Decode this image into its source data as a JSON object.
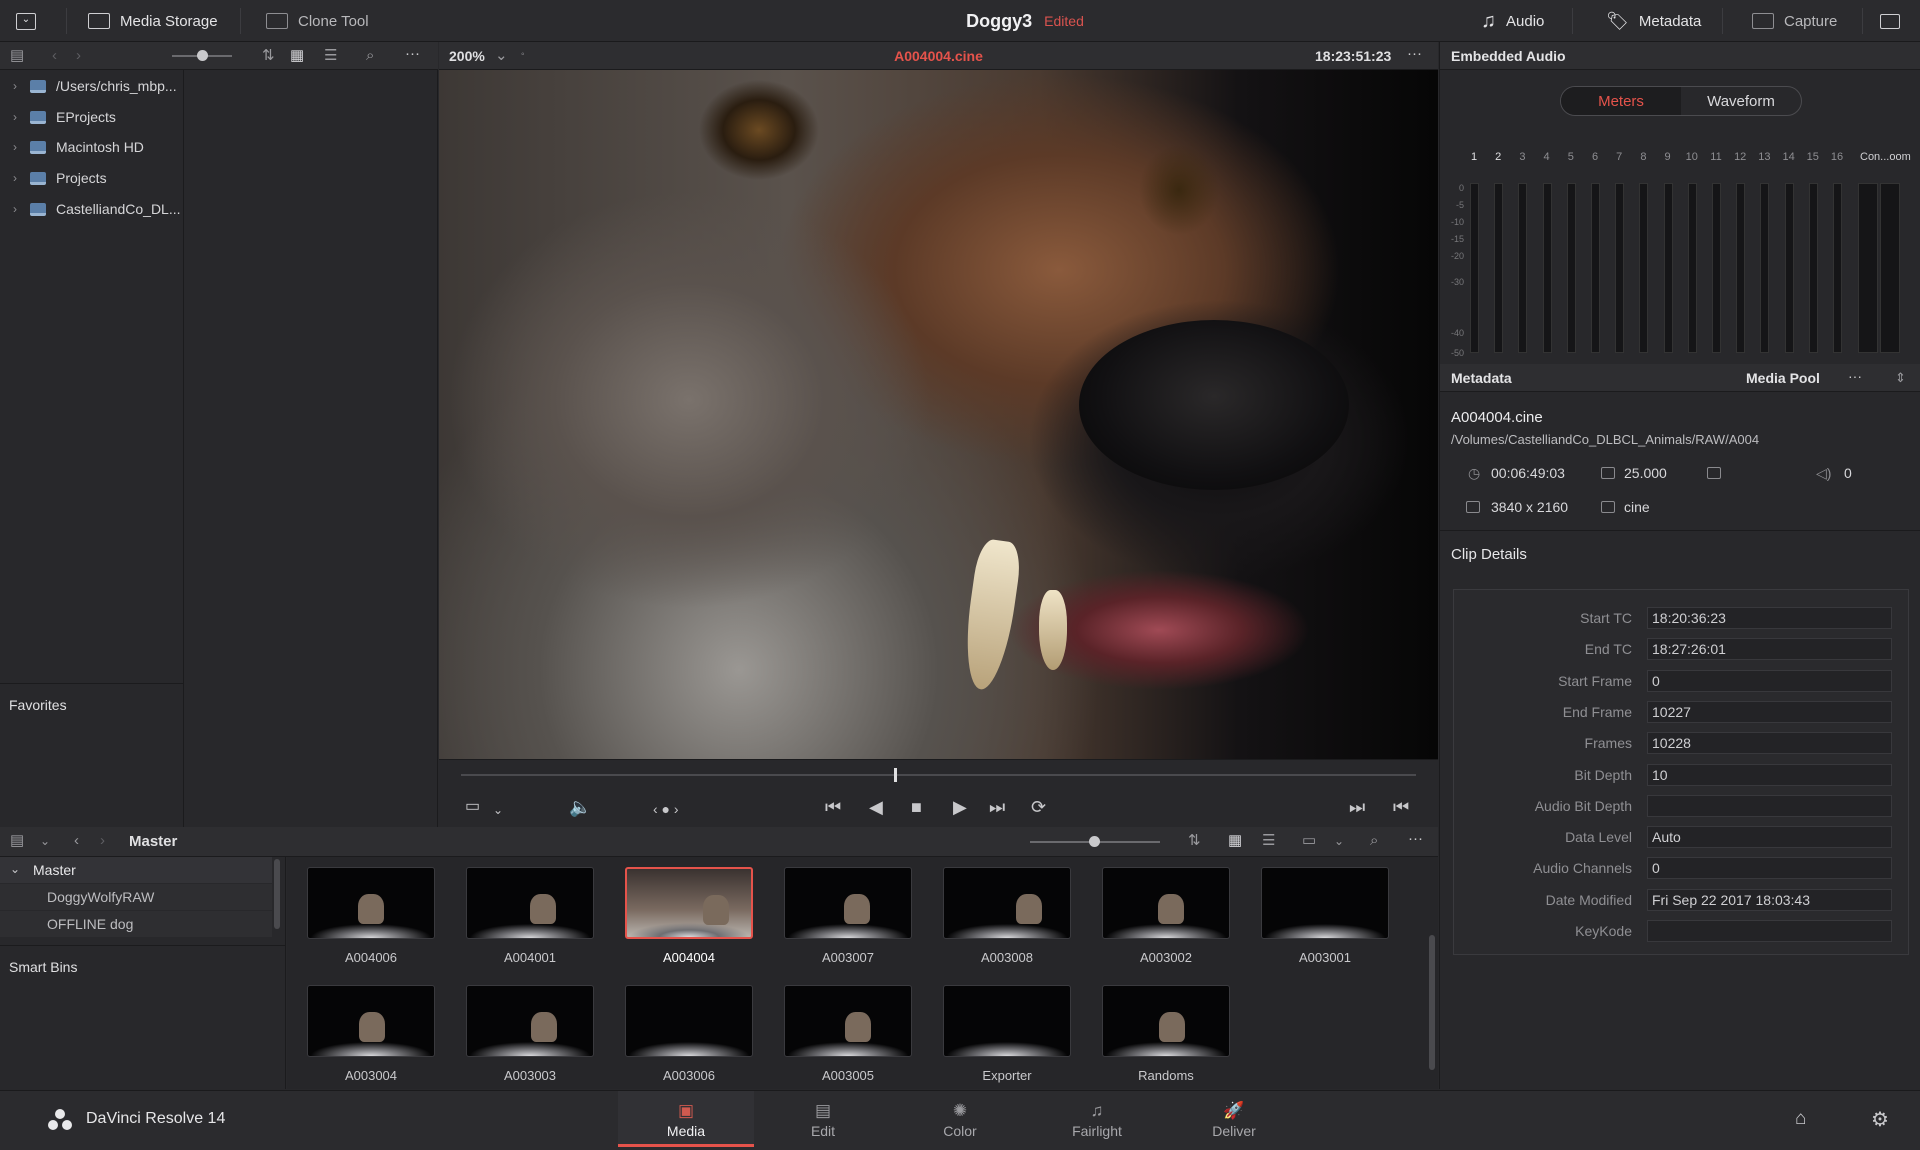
{
  "app": {
    "name": "DaVinci Resolve 14"
  },
  "topbar": {
    "media_storage": "Media Storage",
    "clone_tool": "Clone Tool",
    "project_title": "Doggy3",
    "project_status": "Edited",
    "audio": "Audio",
    "metadata": "Metadata",
    "capture": "Capture"
  },
  "browser": {
    "items": [
      {
        "label": "/Users/chris_mbp..."
      },
      {
        "label": "EProjects"
      },
      {
        "label": "Macintosh HD"
      },
      {
        "label": "Projects"
      },
      {
        "label": "CastelliandCo_DL..."
      }
    ],
    "favorites": "Favorites"
  },
  "viewer": {
    "zoom": "200%",
    "clip_name": "A004004.cine",
    "timecode": "18:23:51:23"
  },
  "audio_panel": {
    "title": "Embedded Audio",
    "tab_meters": "Meters",
    "tab_waveform": "Waveform",
    "channels": [
      "1",
      "2",
      "3",
      "4",
      "5",
      "6",
      "7",
      "8",
      "9",
      "10",
      "11",
      "12",
      "13",
      "14",
      "15",
      "16"
    ],
    "extra_label": "Con...oom",
    "db_scale": [
      "0",
      "-5",
      "-10",
      "-15",
      "-20",
      "-30",
      "-40",
      "-50"
    ]
  },
  "metadata_panel": {
    "title": "Metadata",
    "source": "Media Pool",
    "clip_name": "A004004.cine",
    "clip_path": "/Volumes/CastelliandCo_DLBCL_Animals/RAW/A004",
    "duration": "00:06:49:03",
    "fps": "25.000",
    "audio_ch": "0",
    "resolution": "3840 x 2160",
    "codec": "cine",
    "details_title": "Clip Details",
    "details": [
      {
        "label": "Start TC",
        "value": "18:20:36:23"
      },
      {
        "label": "End TC",
        "value": "18:27:26:01"
      },
      {
        "label": "Start Frame",
        "value": "0"
      },
      {
        "label": "End Frame",
        "value": "10227"
      },
      {
        "label": "Frames",
        "value": "10228"
      },
      {
        "label": "Bit Depth",
        "value": "10"
      },
      {
        "label": "Audio Bit Depth",
        "value": ""
      },
      {
        "label": "Data Level",
        "value": "Auto"
      },
      {
        "label": "Audio Channels",
        "value": "0"
      },
      {
        "label": "Date Modified",
        "value": "Fri Sep 22 2017 18:03:43"
      },
      {
        "label": "KeyKode",
        "value": ""
      }
    ]
  },
  "media_pool": {
    "bin_title": "Master",
    "bins": [
      {
        "label": "Master"
      },
      {
        "label": "DoggyWolfyRAW"
      },
      {
        "label": "OFFLINE dog"
      }
    ],
    "smart_bins": "Smart Bins",
    "clips": [
      {
        "label": "A004006"
      },
      {
        "label": "A004001"
      },
      {
        "label": "A004004"
      },
      {
        "label": "A003007"
      },
      {
        "label": "A003008"
      },
      {
        "label": "A003002"
      },
      {
        "label": "A003001"
      },
      {
        "label": "A003004"
      },
      {
        "label": "A003003"
      },
      {
        "label": "A003006"
      },
      {
        "label": "A003005"
      },
      {
        "label": "Exporter"
      },
      {
        "label": "Randoms"
      }
    ],
    "selected_clip": "A004004"
  },
  "pages": [
    {
      "label": "Media",
      "icon": "media-icon"
    },
    {
      "label": "Edit",
      "icon": "edit-icon"
    },
    {
      "label": "Color",
      "icon": "color-icon"
    },
    {
      "label": "Fairlight",
      "icon": "fairlight-icon"
    },
    {
      "label": "Deliver",
      "icon": "deliver-icon"
    }
  ],
  "active_page": "Media",
  "colors": {
    "accent": "#e5534b",
    "background": "#28282b"
  }
}
